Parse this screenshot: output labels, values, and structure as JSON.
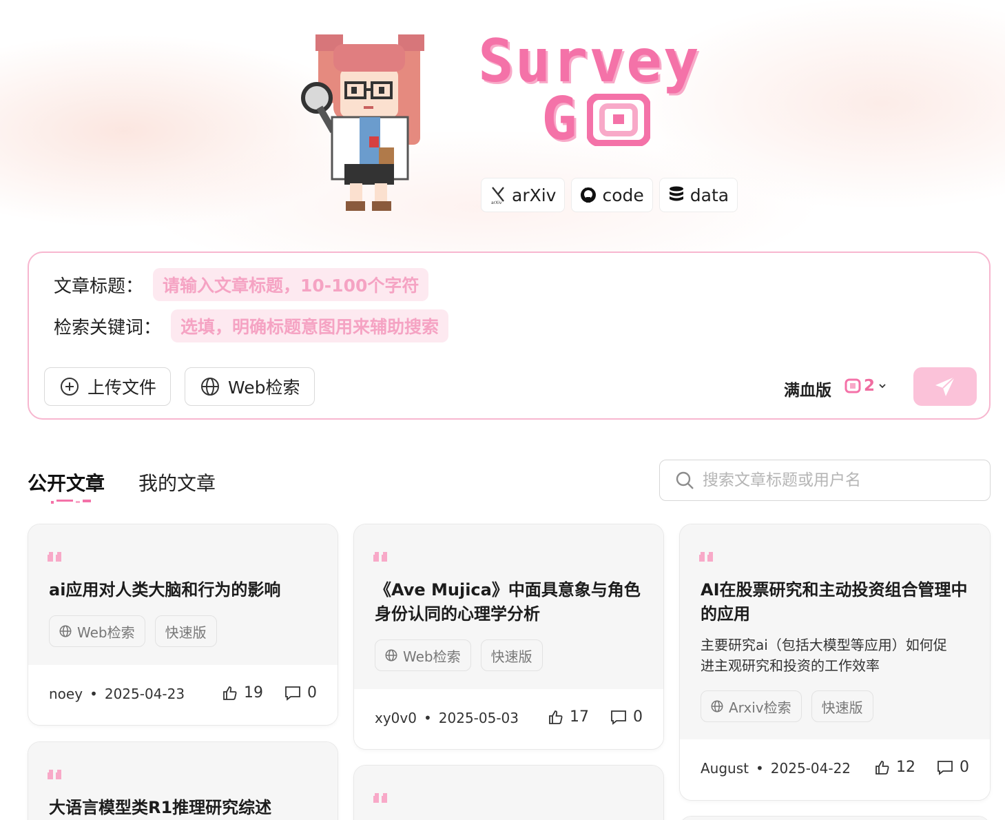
{
  "header": {
    "logo_line1": "Survey",
    "logo_line2": "G",
    "links": [
      {
        "label": "arXiv",
        "icon": "arxiv-icon"
      },
      {
        "label": "code",
        "icon": "github-icon"
      },
      {
        "label": "data",
        "icon": "database-icon"
      }
    ]
  },
  "composer": {
    "title_label": "文章标题：",
    "title_placeholder": "请输入文章标题，10-100个字符",
    "keywords_label": "检索关键词：",
    "keywords_placeholder": "选填，明确标题意图用来辅助搜索",
    "upload_label": "上传文件",
    "web_search_label": "Web检索",
    "mode_label": "满血版",
    "mode_count": "2",
    "accent_color": "#f472a8"
  },
  "tabs": {
    "public": "公开文章",
    "mine": "我的文章"
  },
  "search": {
    "placeholder": "搜索文章标题或用户名"
  },
  "articles": [
    {
      "title": "ai应用对人类大脑和行为的影响",
      "tags": [
        "Web检索",
        "快速版"
      ],
      "author": "noey",
      "date": "2025-04-23",
      "likes": "19",
      "comments": "0"
    },
    {
      "title": "《Ave Mujica》中面具意象与角色身份认同的心理学分析",
      "title_line1": "《Ave Mujica》中面具意象与角色",
      "title_line2": "身份认同的心理学分析",
      "tags": [
        "Web检索",
        "快速版"
      ],
      "author": "xy0v0",
      "date": "2025-05-03",
      "likes": "17",
      "comments": "0"
    },
    {
      "title_line1": "AI在股票研究和主动投资组合管理中",
      "title_line2": "的应用",
      "desc_line1": "主要研究ai（包括大模型等应用）如何促",
      "desc_line2": "进主观研究和投资的工作效率",
      "tags": [
        "Arxiv检索",
        "快速版"
      ],
      "author": "August",
      "date": "2025-04-22",
      "likes": "12",
      "comments": "0"
    },
    {
      "title": "大语言模型类R1推理研究综述"
    }
  ]
}
